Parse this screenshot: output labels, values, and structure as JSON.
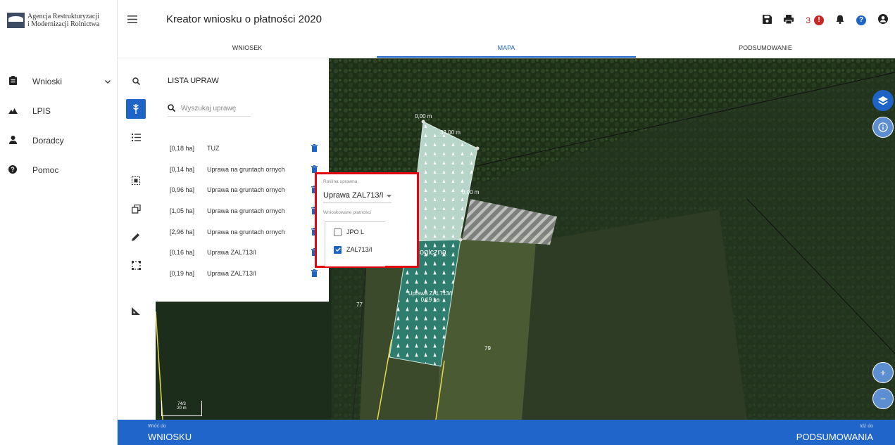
{
  "logo": {
    "line1": "Agencja Restrukturyzacji",
    "line2": "i Modernizacji Rolnictwa"
  },
  "sidebar": {
    "items": [
      {
        "label": "Wnioski",
        "icon": "clipboard-icon",
        "chevron": "⌄"
      },
      {
        "label": "LPIS",
        "icon": "mountain-icon"
      },
      {
        "label": "Doradcy",
        "icon": "person-icon"
      },
      {
        "label": "Pomoc",
        "icon": "question-icon"
      }
    ]
  },
  "header": {
    "title": "Kreator wniosku o płatności 2020",
    "notification_count": "3"
  },
  "tabs": [
    {
      "label": "WNIOSEK",
      "active": false
    },
    {
      "label": "MAPA",
      "active": true
    },
    {
      "label": "PODSUMOWANIE",
      "active": false
    }
  ],
  "crop_panel": {
    "title": "LISTA UPRAW",
    "search_placeholder": "Wyszukaj uprawę",
    "crops": [
      {
        "area": "[0,18 ha]",
        "name": "TUZ"
      },
      {
        "area": "[0,14 ha]",
        "name": "Uprawa na gruntach ornych"
      },
      {
        "area": "[0,96 ha]",
        "name": "Uprawa na gruntach ornych"
      },
      {
        "area": "[1,05 ha]",
        "name": "Uprawa na gruntach ornych"
      },
      {
        "area": "[2,96 ha]",
        "name": "Uprawa na gruntach ornych"
      },
      {
        "area": "[0,16 ha]",
        "name": "Uprawa ZAL713/I"
      },
      {
        "area": "[0,19 ha]",
        "name": "Uprawa ZAL713/I"
      }
    ]
  },
  "popup": {
    "crop_label": "Roślina uprawna",
    "crop_value": "Uprawa ZAL713/I",
    "payments_label": "Wnioskowane płatności",
    "payments": [
      {
        "label": "JPO L",
        "checked": false
      },
      {
        "label": "ZAL713/I",
        "checked": true
      }
    ]
  },
  "map": {
    "measure_1": "0,00 m",
    "measure_2": "32,00 m",
    "measure_3": "0,00 m",
    "parcel_77": "77",
    "parcel_79": "79",
    "crop_label_line1": "Uprawa ZAL713/I",
    "crop_label_line2": "0,19 ha",
    "partial_text": "ogiczna",
    "scale_top": "74/3",
    "scale_bottom": "20 m"
  },
  "footer": {
    "back_small": "Wróć do",
    "back_big": "WNIOSKU",
    "next_small": "Idź do",
    "next_big": "PODSUMOWANIA"
  },
  "colors": {
    "primary": "#1e63c6",
    "footer": "#2065c9",
    "highlight": "#e30613"
  }
}
